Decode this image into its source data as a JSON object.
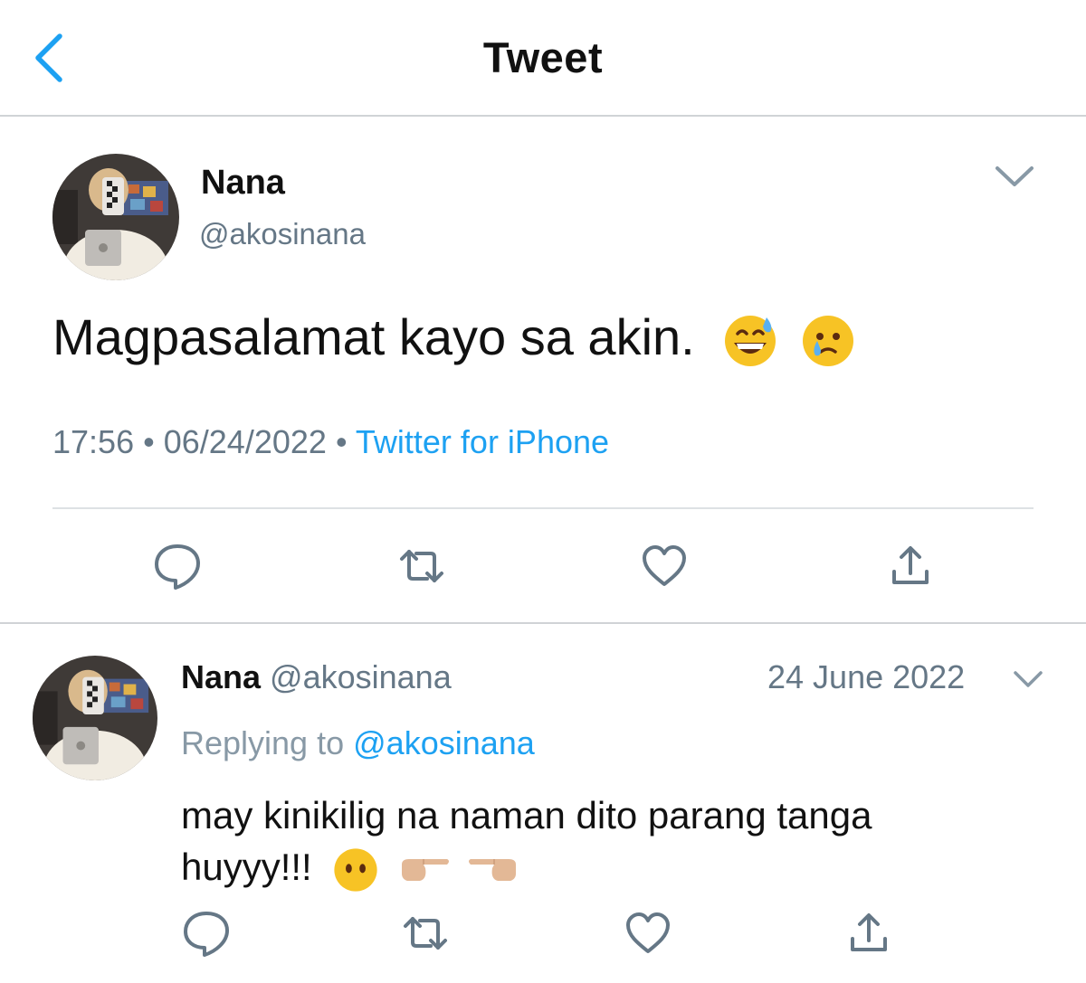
{
  "header": {
    "title": "Tweet",
    "back_icon": "chevron-left-icon"
  },
  "colors": {
    "accent": "#1da1f2",
    "muted": "#657786",
    "text": "#111111"
  },
  "main_tweet": {
    "name": "Nana",
    "handle": "@akosinana",
    "text": "Magpasalamat kayo sa akin.",
    "emojis": [
      "grinning-sweat-emoji",
      "face-holding-back-tears-emoji"
    ],
    "time": "17:56",
    "dot1": "•",
    "date": "06/24/2022",
    "dot2": "•",
    "source": "Twitter for iPhone",
    "actions": [
      "reply-icon",
      "retweet-icon",
      "like-icon",
      "share-icon"
    ]
  },
  "reply_tweet": {
    "name": "Nana",
    "handle": "@akosinana",
    "date": "24 June 2022",
    "replying_label": "Replying to",
    "replying_handle": "@akosinana",
    "text_line1": "may kinikilig na naman dito parang tanga",
    "text_line2": "huyyy!!!",
    "emojis": [
      "face-without-mouth-emoji",
      "pointing-right-emoji",
      "pointing-left-emoji"
    ],
    "actions": [
      "reply-icon",
      "retweet-icon",
      "like-icon",
      "share-icon"
    ]
  }
}
